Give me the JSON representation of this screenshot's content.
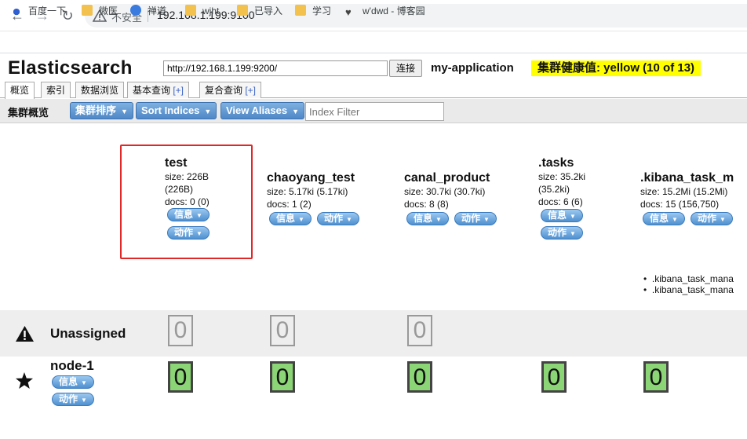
{
  "browser": {
    "insecure_label": "不安全",
    "url": "192.168.1.199:9100",
    "bookmarks": [
      {
        "label": "百度一下",
        "icon": "paw-icon"
      },
      {
        "label": "微医",
        "icon": "folder-icon"
      },
      {
        "label": "禅道",
        "icon": "globe-icon"
      },
      {
        "label": "wjht",
        "icon": "folder-icon"
      },
      {
        "label": "已导入",
        "icon": "folder-icon"
      },
      {
        "label": "学习",
        "icon": "folder-icon"
      },
      {
        "label": "w'dwd - 博客园",
        "icon": "blog-icon"
      }
    ]
  },
  "app": {
    "title": "Elasticsearch",
    "connect_url": "http://192.168.1.199:9200/",
    "connect_label": "连接",
    "cluster_name": "my-application",
    "health": "集群健康值: yellow (10 of 13)"
  },
  "tabs": [
    {
      "label": "概览",
      "plus": ""
    },
    {
      "label": "索引",
      "plus": ""
    },
    {
      "label": "数据浏览",
      "plus": ""
    },
    {
      "label": "基本查询 ",
      "plus": "[+]"
    },
    {
      "label": "复合查询 ",
      "plus": "[+]"
    }
  ],
  "toolbar": {
    "label": "集群概览",
    "sort_cluster": "集群排序",
    "sort_indices": "Sort Indices",
    "view_aliases": "View Aliases",
    "filter_placeholder": "Index Filter"
  },
  "pill_labels": {
    "info": "信息",
    "action": "动作"
  },
  "indices": [
    {
      "name": "test",
      "size_a": "size: 226B",
      "size_b": "(226B)",
      "docs": "docs: 0 (0)"
    },
    {
      "name": "chaoyang_test",
      "size": "size: 5.17ki (5.17ki)",
      "docs": "docs: 1 (2)"
    },
    {
      "name": "canal_product",
      "size": "size: 30.7ki (30.7ki)",
      "docs": "docs: 8 (8)"
    },
    {
      "name": ".tasks",
      "size_a": "size: 35.2ki",
      "size_b": "(35.2ki)",
      "docs": "docs: 6 (6)"
    },
    {
      "name": ".kibana_task_m",
      "size": "size: 15.2Mi (15.2Mi)",
      "docs": "docs: 15 (156,750)"
    }
  ],
  "aliases": [
    ".kibana_task_mana",
    ".kibana_task_mana"
  ],
  "rows": {
    "unassigned_label": "Unassigned",
    "node_label": "node-1",
    "unassigned_shards": [
      "0",
      "0",
      "0"
    ],
    "node_shards": [
      "0",
      "0",
      "0",
      "0",
      "0"
    ]
  }
}
